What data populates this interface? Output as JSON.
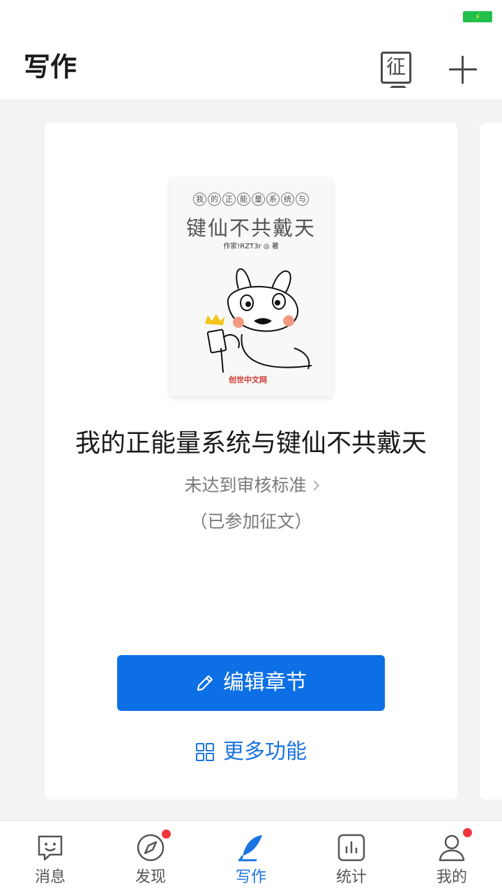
{
  "header": {
    "title": "写作",
    "contest_icon_char": "征"
  },
  "book": {
    "cover": {
      "circle_chars": [
        "我",
        "的",
        "正",
        "能",
        "量",
        "系",
        "统",
        "与"
      ],
      "title_line2": "键仙不共戴天",
      "author_line": "作家!RZT3r ◎ 著",
      "brand": "创世中文网"
    },
    "title": "我的正能量系统与键仙不共戴天",
    "review_status": "未达到审核标准",
    "contest_note": "（已参加征文）"
  },
  "actions": {
    "edit_label": "编辑章节",
    "more_label": "更多功能"
  },
  "tabbar": {
    "items": [
      {
        "label": "消息",
        "icon": "chat-bubble-icon",
        "badge": false
      },
      {
        "label": "发现",
        "icon": "compass-icon",
        "badge": true
      },
      {
        "label": "写作",
        "icon": "quill-icon",
        "badge": false,
        "active": true
      },
      {
        "label": "统计",
        "icon": "bar-chart-icon",
        "badge": false
      },
      {
        "label": "我的",
        "icon": "user-icon",
        "badge": true
      }
    ]
  },
  "colors": {
    "accent": "#0d6fe6",
    "badge": "#f0363d",
    "battery": "#22c04a"
  }
}
